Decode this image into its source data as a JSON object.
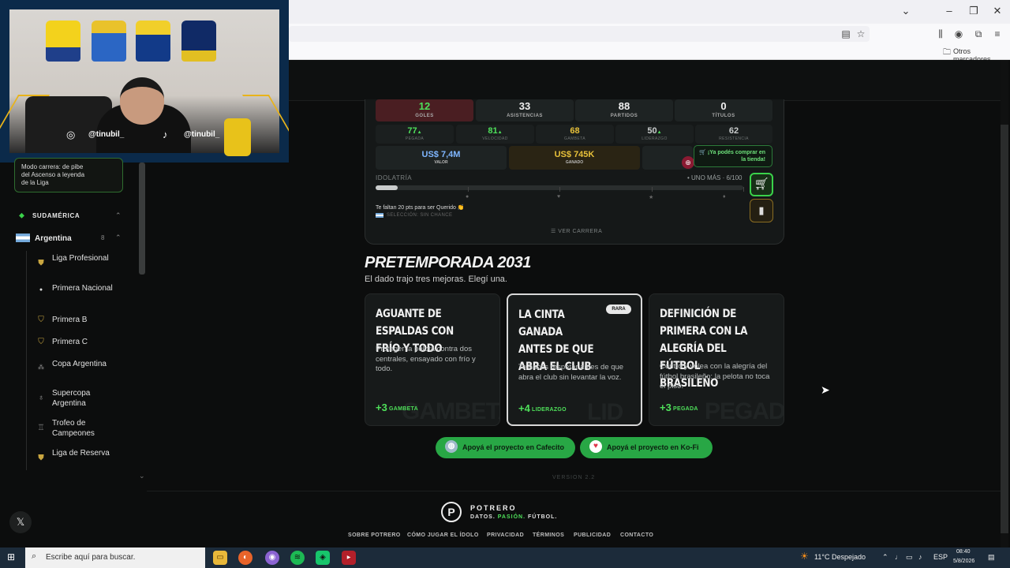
{
  "browser": {
    "bookmark_folder": "Otros marcadores"
  },
  "webcam": {
    "handle_left": "@tinubil_",
    "handle_right": "@tinubil_"
  },
  "sidebar": {
    "promo": "Modo carrera: de pibe del Ascenso a leyenda de la Liga",
    "region": "SUDAMÉRICA",
    "country": "Argentina",
    "country_count": "8",
    "leagues": [
      "Liga Profesional",
      "Primera Nacional",
      "Primera B",
      "Primera C",
      "Copa Argentina",
      "Supercopa Argentina",
      "Trofeo de Campeones",
      "Liga de Reserva"
    ]
  },
  "career": {
    "stats": [
      {
        "value": "12",
        "label": "GOLES"
      },
      {
        "value": "33",
        "label": "ASISTENCIAS"
      },
      {
        "value": "88",
        "label": "PARTIDOS"
      },
      {
        "value": "0",
        "label": "TÍTULOS"
      }
    ],
    "attributes": [
      {
        "value": "77",
        "arrow": "▲",
        "label": "PEGADA",
        "color": "#4ee05a"
      },
      {
        "value": "81",
        "arrow": "▲",
        "label": "VELOCIDAD",
        "color": "#4ee05a"
      },
      {
        "value": "68",
        "arrow": "",
        "label": "GAMBETA",
        "color": "#e8c13a"
      },
      {
        "value": "50",
        "arrow": "▲",
        "label": "LIDERAZGO",
        "color": "#c9cccc"
      },
      {
        "value": "62",
        "arrow": "",
        "label": "RESISTENCIA",
        "color": "#c9cccc"
      }
    ],
    "value_amount": "US$ 7,4M",
    "value_label": "VALOR",
    "earned_amount": "US$ 745K",
    "earned_label": "GANADO",
    "store_tooltip": "🛒 ¡Ya podés comprar en la tienda!",
    "idol_label": "IDOLATRÍA",
    "idol_status": "• UNO MÁS · 6/100",
    "idol_progress": 0.06,
    "idol_hint": "Te faltan 20 pts para ser Querido 👏",
    "seleccion": "SELECCIÓN: SIN CHANCE",
    "ver_carrera": "☰ VER CARRERA"
  },
  "pretemporada": {
    "title": "PRETEMPORADA 2031",
    "subtitle": "El dado trajo tres mejoras. Elegí una.",
    "choices": [
      {
        "title": "Aguante de espaldas con frío y todo",
        "desc": "Proteger la pelota contra dos centrales, ensayado con frío y todo.",
        "plus": "+3",
        "stat": "GAMBETA",
        "watermark": "GAMBETA"
      },
      {
        "title": "La cinta ganada antes de que abra el club",
        "desc": "Te hacés respetar antes de que abra el club sin levantar la voz.",
        "plus": "+4",
        "stat": "LIDERAZGO",
        "watermark": "LID",
        "badge": "RARA"
      },
      {
        "title": "Definición de primera con la alegría del fútbol brasileño",
        "desc": "Centro y volea con la alegría del fútbol brasileño: la pelota no toca el piso.",
        "plus": "+3",
        "stat": "PEGADA",
        "watermark": "PEGADA"
      }
    ]
  },
  "support": {
    "cafecito": "Apoyá el proyecto en Cafecito",
    "kofi": "Apoyá el proyecto en Ko-Fi"
  },
  "version": "VERSION 2.2",
  "footer": {
    "brand": "POTRERO",
    "tag_a": "DATOS.",
    "tag_b": "PASIÓN.",
    "tag_c": "FÚTBOL.",
    "links": [
      "SOBRE POTRERO",
      "CÓMO JUGAR EL ÍDOLO",
      "PRIVACIDAD",
      "TÉRMINOS",
      "PUBLICIDAD",
      "CONTACTO"
    ]
  },
  "taskbar": {
    "search_placeholder": "Escribe aquí para buscar.",
    "weather": "11°C  Despejado",
    "lang": "ESP",
    "time": "08:40",
    "date": "5/8/2026"
  },
  "colors": {
    "accent_green": "#4ee05a",
    "brand_green": "#28a745",
    "gold": "#e8c13a"
  }
}
